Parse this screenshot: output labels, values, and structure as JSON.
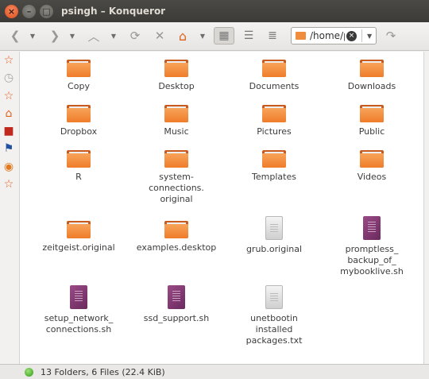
{
  "window": {
    "title": "psingh – Konqueror",
    "close_glyph": "×",
    "minimize_glyph": "–",
    "maximize_glyph": "□"
  },
  "toolbar": {
    "back_icon": "back-arrow-icon",
    "forward_icon": "forward-arrow-icon",
    "up_icon": "up-arrow-icon",
    "reload_icon": "reload-icon",
    "stop_icon": "stop-icon",
    "home_icon": "home-icon",
    "icon_view": "icon-view-icon",
    "detail_view": "detail-view-icon",
    "tree_view": "tree-view-icon",
    "go_icon": "go-icon",
    "location": "/home/p",
    "clear_glyph": "×"
  },
  "sidebar": {
    "items": [
      {
        "icon": "bookmarks-icon",
        "glyph": "☆",
        "color": "#e0601e"
      },
      {
        "icon": "history-icon",
        "glyph": "◷",
        "color": "#a8a6a1"
      },
      {
        "icon": "favorites-icon",
        "glyph": "☆",
        "color": "#e0601e"
      },
      {
        "icon": "home-icon",
        "glyph": "⌂",
        "color": "#e0601e"
      },
      {
        "icon": "storage-icon",
        "glyph": "■",
        "color": "#c0281e"
      },
      {
        "icon": "services-icon",
        "glyph": "⚑",
        "color": "#2050a0"
      },
      {
        "icon": "network-icon",
        "glyph": "◉",
        "color": "#e07a1e"
      },
      {
        "icon": "root-folder-icon",
        "glyph": "☆",
        "color": "#e0601e"
      }
    ]
  },
  "files": [
    {
      "label": "Copy",
      "type": "folder"
    },
    {
      "label": "Desktop",
      "type": "folder"
    },
    {
      "label": "Documents",
      "type": "folder"
    },
    {
      "label": "Downloads",
      "type": "folder"
    },
    {
      "label": "Dropbox",
      "type": "folder"
    },
    {
      "label": "Music",
      "type": "folder"
    },
    {
      "label": "Pictures",
      "type": "folder"
    },
    {
      "label": "Public",
      "type": "folder"
    },
    {
      "label": "R",
      "type": "folder"
    },
    {
      "label": "system-\nconnections.\noriginal",
      "type": "folder"
    },
    {
      "label": "Templates",
      "type": "folder"
    },
    {
      "label": "Videos",
      "type": "folder"
    },
    {
      "label": "zeitgeist.original",
      "type": "folder"
    },
    {
      "label": "examples.desktop",
      "type": "folder"
    },
    {
      "label": "grub.original",
      "type": "text"
    },
    {
      "label": "promptless_\nbackup_of_\nmybooklive.sh",
      "type": "script"
    },
    {
      "label": "setup_network_\nconnections.sh",
      "type": "script"
    },
    {
      "label": "ssd_support.sh",
      "type": "script"
    },
    {
      "label": "unetbootin\ninstalled\npackages.txt",
      "type": "text"
    }
  ],
  "status": {
    "text": "13 Folders, 6 Files (22.4 KiB)"
  }
}
